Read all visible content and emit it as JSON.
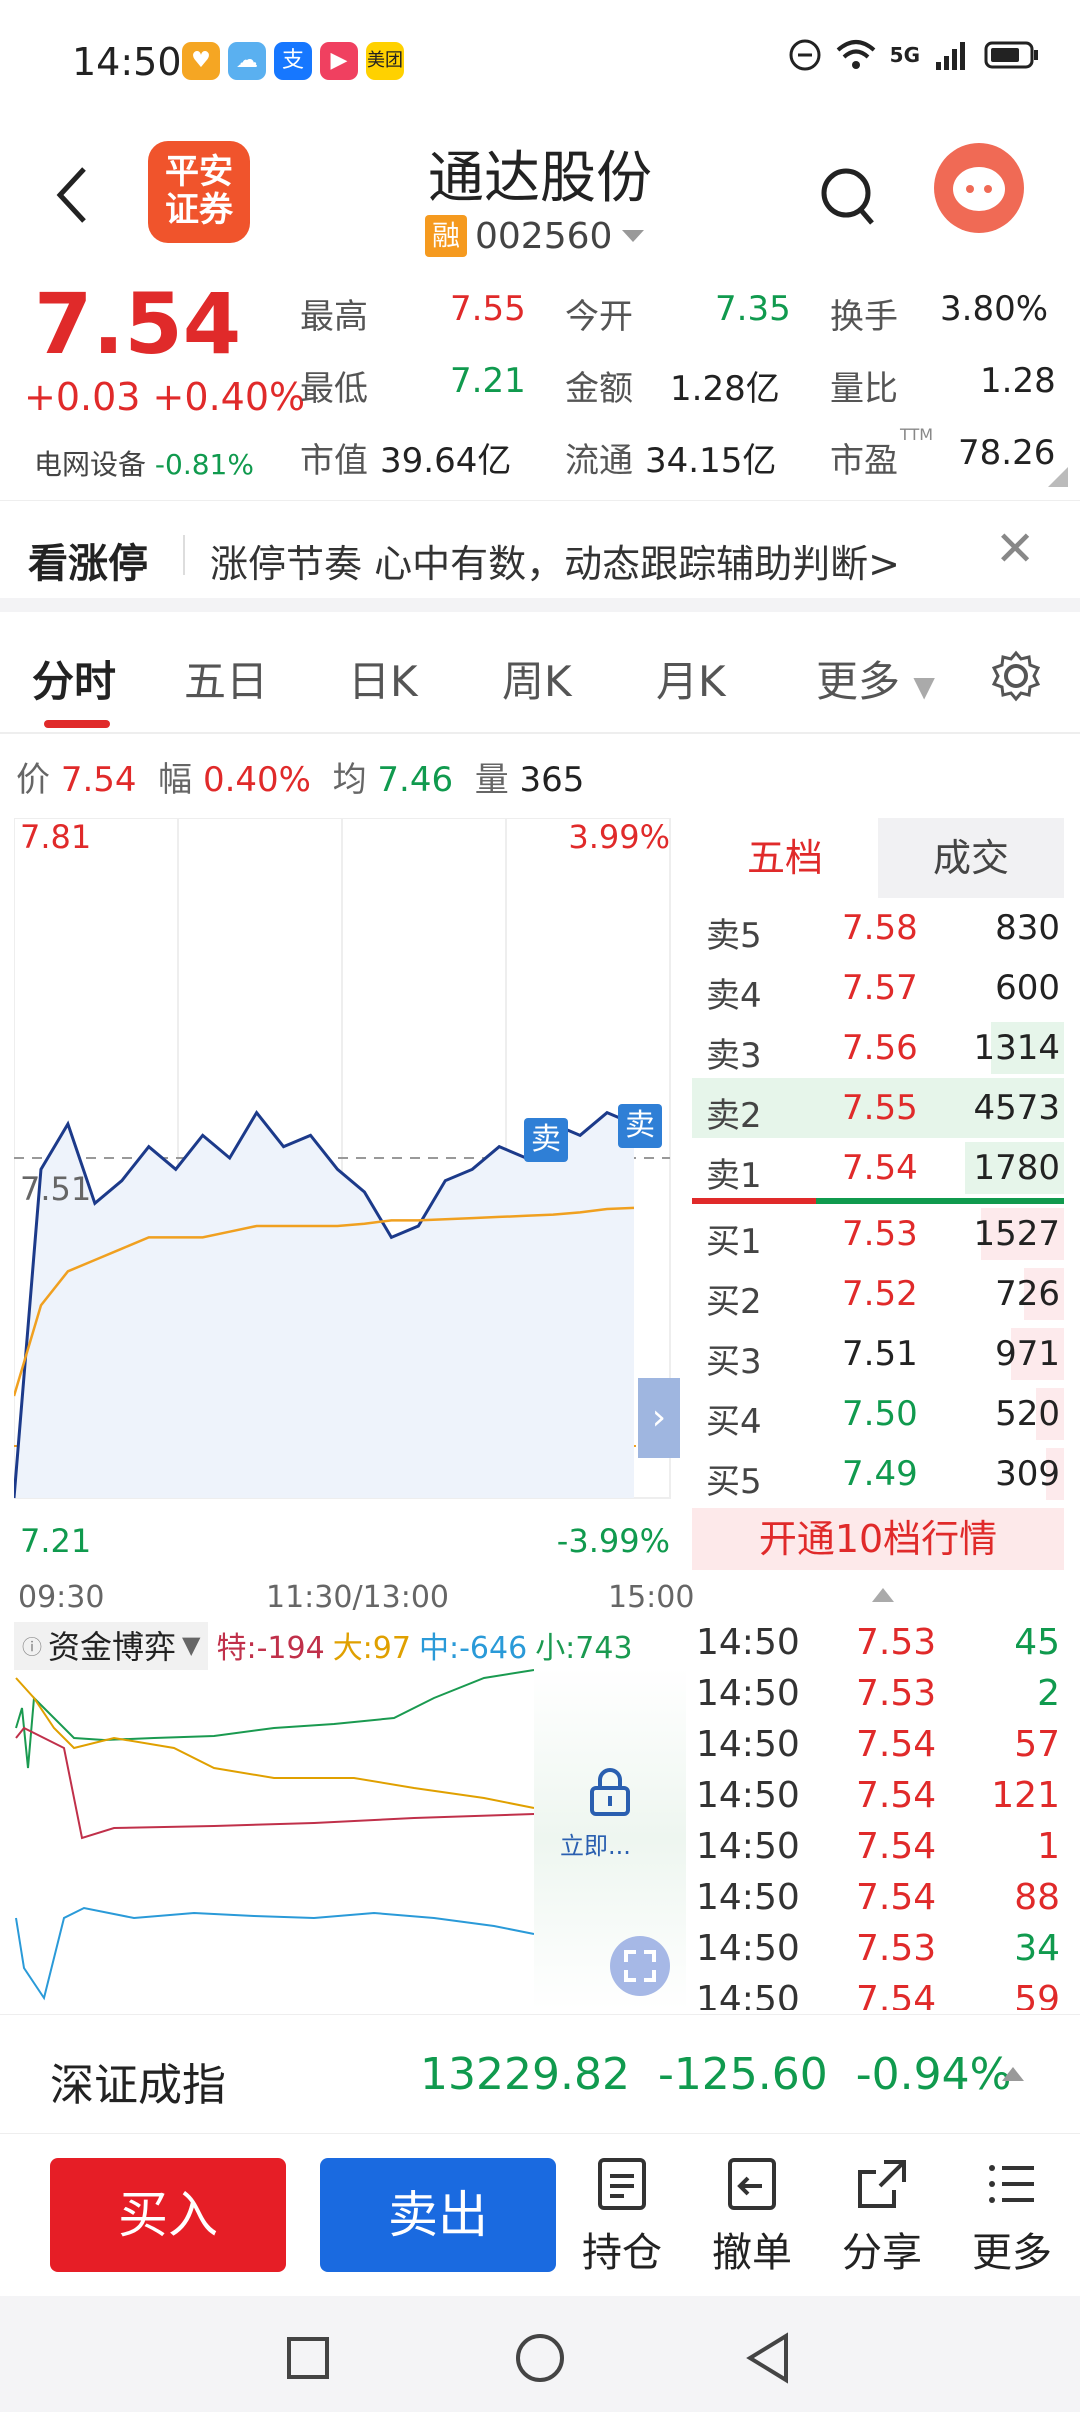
{
  "status": {
    "time": "14:50",
    "network": "5G"
  },
  "header": {
    "title": "通达股份",
    "code": "002560",
    "tag": "融",
    "logo_text_1": "平安",
    "logo_text_2": "证券"
  },
  "quote": {
    "price": "7.54",
    "change": "+0.03",
    "change_pct": "+0.40%",
    "sector": "电网设备",
    "sector_pct": "-0.81%",
    "stats": [
      {
        "k": "最高",
        "v": "7.55"
      },
      {
        "k": "今开",
        "v": "7.35"
      },
      {
        "k": "换手",
        "v": "3.80%"
      },
      {
        "k": "最低",
        "v": "7.21"
      },
      {
        "k": "金额",
        "v": "1.28亿"
      },
      {
        "k": "量比",
        "v": "1.28"
      },
      {
        "k": "市值",
        "v": "39.64亿"
      },
      {
        "k": "流通",
        "v": "34.15亿"
      },
      {
        "k": "市盈",
        "v": "78.26"
      }
    ],
    "ttm": "TTM"
  },
  "banner": {
    "title": "看涨停",
    "text": "涨停节奏 心中有数，动态跟踪辅助判断>",
    "close": "✕"
  },
  "tabs": [
    "分时",
    "五日",
    "日K",
    "周K",
    "月K",
    "更多"
  ],
  "info": {
    "price_k": "价",
    "price_v": "7.54",
    "amp_k": "幅",
    "amp_v": "0.40%",
    "avg_k": "均",
    "avg_v": "7.46",
    "vol_k": "量",
    "vol_v": "365"
  },
  "chart": {
    "top_price": "7.81",
    "top_pct": "3.99%",
    "mid_price": "7.51",
    "bot_price": "7.21",
    "bot_pct": "-3.99%",
    "time_start": "09:30",
    "time_mid": "11:30/13:00",
    "time_end": "15:00",
    "sell_tag": "卖"
  },
  "chart_data": {
    "type": "line",
    "title": "",
    "x": [
      "09:30",
      "11:30/13:00",
      "15:00"
    ],
    "ylim": [
      7.21,
      7.81
    ],
    "ref_price": 7.51,
    "series": [
      {
        "name": "价",
        "color": "#1c3a8a",
        "values": [
          7.21,
          7.5,
          7.54,
          7.47,
          7.49,
          7.52,
          7.5,
          7.53,
          7.51,
          7.55,
          7.52,
          7.53,
          7.5,
          7.48,
          7.44,
          7.45,
          7.49,
          7.5,
          7.52,
          7.51,
          7.54,
          7.53,
          7.55,
          7.54
        ]
      },
      {
        "name": "均",
        "color": "#f0a020",
        "values": [
          7.3,
          7.38,
          7.41,
          7.42,
          7.43,
          7.44,
          7.44,
          7.44,
          7.445,
          7.45,
          7.45,
          7.45,
          7.45,
          7.452,
          7.455,
          7.455,
          7.456,
          7.457,
          7.458,
          7.459,
          7.46,
          7.462,
          7.465,
          7.466
        ]
      }
    ]
  },
  "orderbook": {
    "tab_active": "五档",
    "tab_other": "成交",
    "asks": [
      {
        "label": "卖5",
        "price": "7.58",
        "vol": "830",
        "frac": 0.0
      },
      {
        "label": "卖4",
        "price": "7.57",
        "vol": "600",
        "frac": 0.0
      },
      {
        "label": "卖3",
        "price": "7.56",
        "vol": "1314",
        "frac": 0.29
      },
      {
        "label": "卖2",
        "price": "7.55",
        "vol": "4573",
        "frac": 1.0
      },
      {
        "label": "卖1",
        "price": "7.54",
        "vol": "1780",
        "frac": 0.39
      }
    ],
    "bids": [
      {
        "label": "买1",
        "price": "7.53",
        "vol": "1527",
        "frac": 0.33,
        "color": "red"
      },
      {
        "label": "买2",
        "price": "7.52",
        "vol": "726",
        "frac": 0.16,
        "color": "red"
      },
      {
        "label": "买3",
        "price": "7.51",
        "vol": "971",
        "frac": 0.21,
        "color": "blk"
      },
      {
        "label": "买4",
        "price": "7.50",
        "vol": "520",
        "frac": 0.11,
        "color": "green"
      },
      {
        "label": "买5",
        "price": "7.49",
        "vol": "309",
        "frac": 0.07,
        "color": "green"
      }
    ],
    "open10": "开通10档行情"
  },
  "fund": {
    "title": "资金博弈",
    "te_k": "特:",
    "te_v": "-194",
    "da_k": "大:",
    "da_v": "97",
    "zh_k": "中:",
    "zh_v": "-646",
    "xi_k": "小:",
    "xi_v": "743",
    "unlock": "立即..."
  },
  "ticks": [
    {
      "t": "14:50",
      "p": "7.53",
      "v": "45",
      "pc": "red",
      "vc": "green"
    },
    {
      "t": "14:50",
      "p": "7.53",
      "v": "2",
      "pc": "red",
      "vc": "green"
    },
    {
      "t": "14:50",
      "p": "7.54",
      "v": "57",
      "pc": "red",
      "vc": "red"
    },
    {
      "t": "14:50",
      "p": "7.54",
      "v": "121",
      "pc": "red",
      "vc": "red"
    },
    {
      "t": "14:50",
      "p": "7.54",
      "v": "1",
      "pc": "red",
      "vc": "red"
    },
    {
      "t": "14:50",
      "p": "7.54",
      "v": "88",
      "pc": "red",
      "vc": "red"
    },
    {
      "t": "14:50",
      "p": "7.53",
      "v": "34",
      "pc": "red",
      "vc": "green"
    },
    {
      "t": "14:50",
      "p": "7.54",
      "v": "59",
      "pc": "red",
      "vc": "red"
    }
  ],
  "index": {
    "name": "深证成指",
    "value": "13229.82",
    "change": "-125.60",
    "pct": "-0.94%"
  },
  "actions": {
    "buy": "买入",
    "sell": "卖出",
    "hold": "持仓",
    "cancel": "撤单",
    "share": "分享",
    "more": "更多"
  }
}
